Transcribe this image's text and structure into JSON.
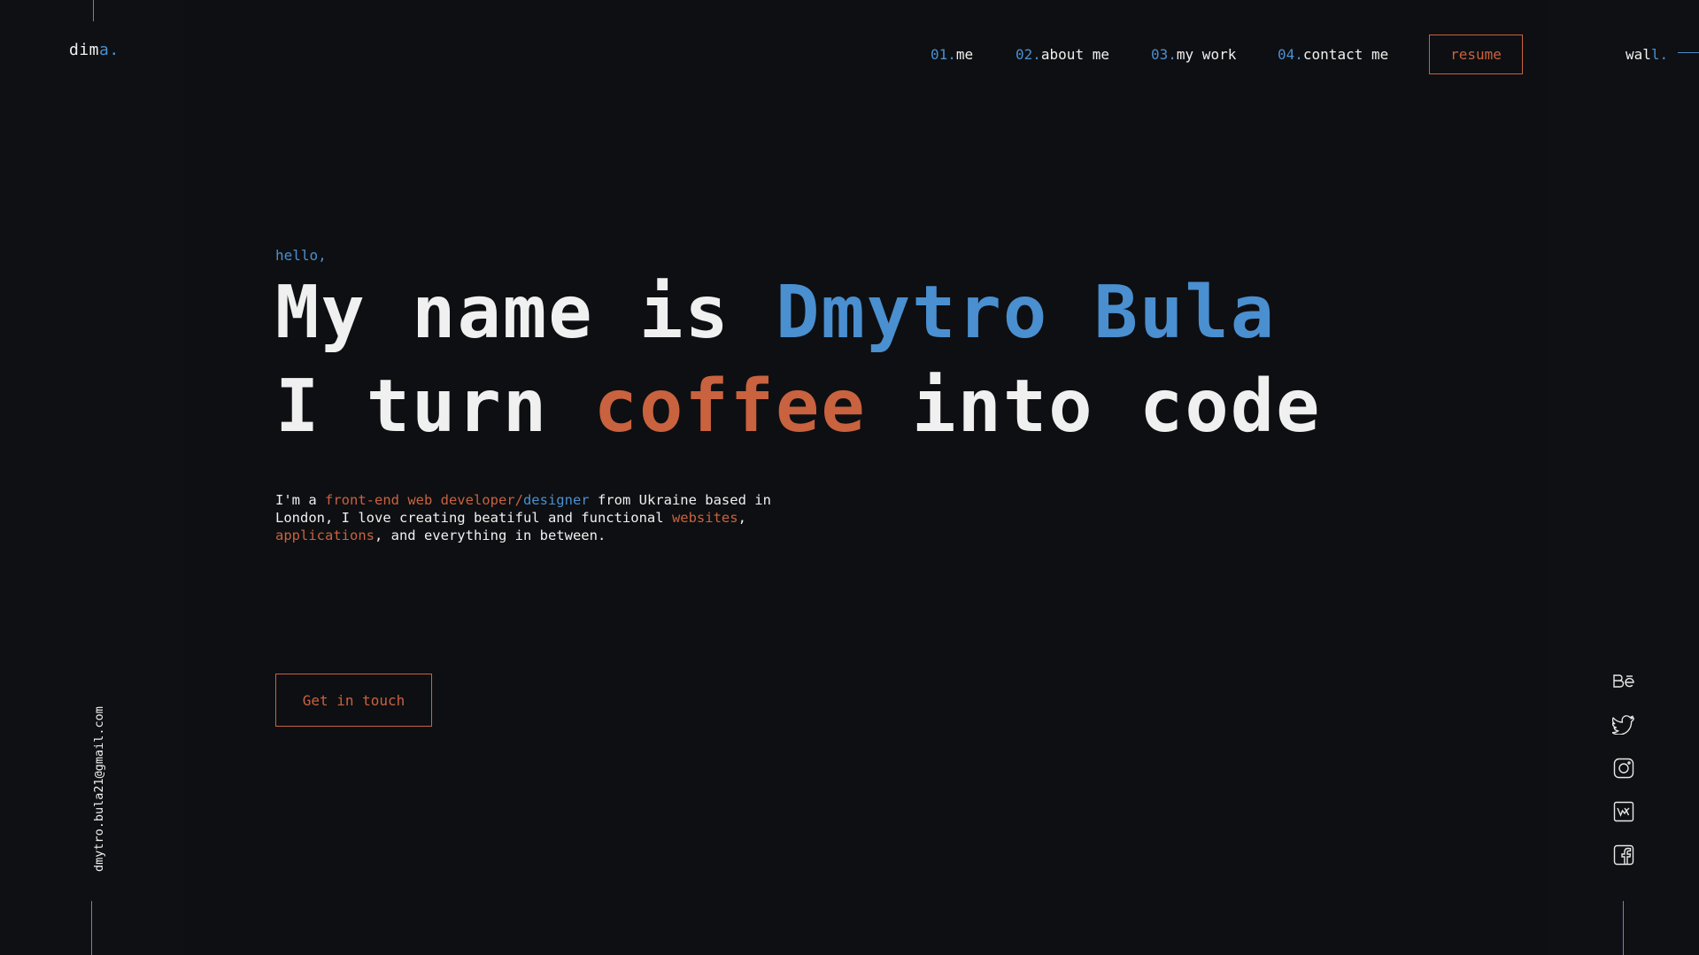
{
  "logo": {
    "prefix": "dim",
    "accent": "a."
  },
  "nav": {
    "items": [
      {
        "num": "01.",
        "label": "me"
      },
      {
        "num": "02.",
        "label": "about me"
      },
      {
        "num": "03.",
        "label": "my work"
      },
      {
        "num": "04.",
        "label": "contact me"
      }
    ],
    "resume_label": "resume"
  },
  "wall": {
    "prefix": "wal",
    "accent": "l."
  },
  "hero": {
    "greeting": "hello,",
    "line1_prefix": "My name is ",
    "line1_name": "Dmytro Bula",
    "line2_prefix": "I turn ",
    "line2_highlight": "coffee",
    "line2_suffix": " into code",
    "intro": {
      "p1": "I'm a ",
      "role_orange": "front-end web developer/",
      "role_blue": "designer",
      "p2": " from Ukraine based in London, I love creating beatiful and functional ",
      "websites": "websites",
      "comma": ",",
      "applications": "applications",
      "p3": ", and everything in between."
    },
    "cta_label": "Get in touch"
  },
  "email": "dmytro.bula21@gmail.com",
  "socials": [
    "behance-icon",
    "twitter-icon",
    "instagram-icon",
    "vk-icon",
    "facebook-icon"
  ],
  "colors": {
    "background": "#0e0f12",
    "blue": "#4a8fd0",
    "orange": "#c9623f",
    "text": "#f0f0f0"
  }
}
